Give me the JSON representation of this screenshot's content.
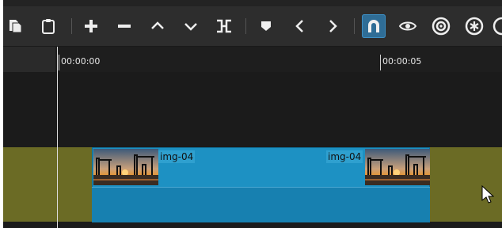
{
  "toolbar": {
    "buttons": [
      {
        "name": "copy",
        "icon": "copy-icon"
      },
      {
        "name": "paste",
        "icon": "paste-icon"
      },
      {
        "name": "append",
        "icon": "plus-icon"
      },
      {
        "name": "remove",
        "icon": "minus-icon"
      },
      {
        "name": "lift",
        "icon": "chevron-up-icon"
      },
      {
        "name": "overwrite",
        "icon": "chevron-down-icon"
      },
      {
        "name": "split",
        "icon": "split-icon"
      },
      {
        "name": "marker",
        "icon": "marker-icon"
      },
      {
        "name": "previous-marker",
        "icon": "chevron-left-icon"
      },
      {
        "name": "next-marker",
        "icon": "chevron-right-icon"
      },
      {
        "name": "snap",
        "icon": "magnet-icon",
        "active": true
      },
      {
        "name": "scrub",
        "icon": "eye-icon"
      },
      {
        "name": "ripple",
        "icon": "target-icon"
      },
      {
        "name": "ripple-all",
        "icon": "asterisk-icon"
      }
    ]
  },
  "ruler": {
    "ticks": [
      {
        "label": "00:00:00"
      },
      {
        "label": "00:00:05"
      }
    ]
  },
  "clip": {
    "label_left": "img-04",
    "label_right": "img-04"
  },
  "colors": {
    "track": "#6b6b25",
    "clip": "#1d91c3",
    "toolbar": "#2d2d2d",
    "active_button": "#2f6d96"
  }
}
